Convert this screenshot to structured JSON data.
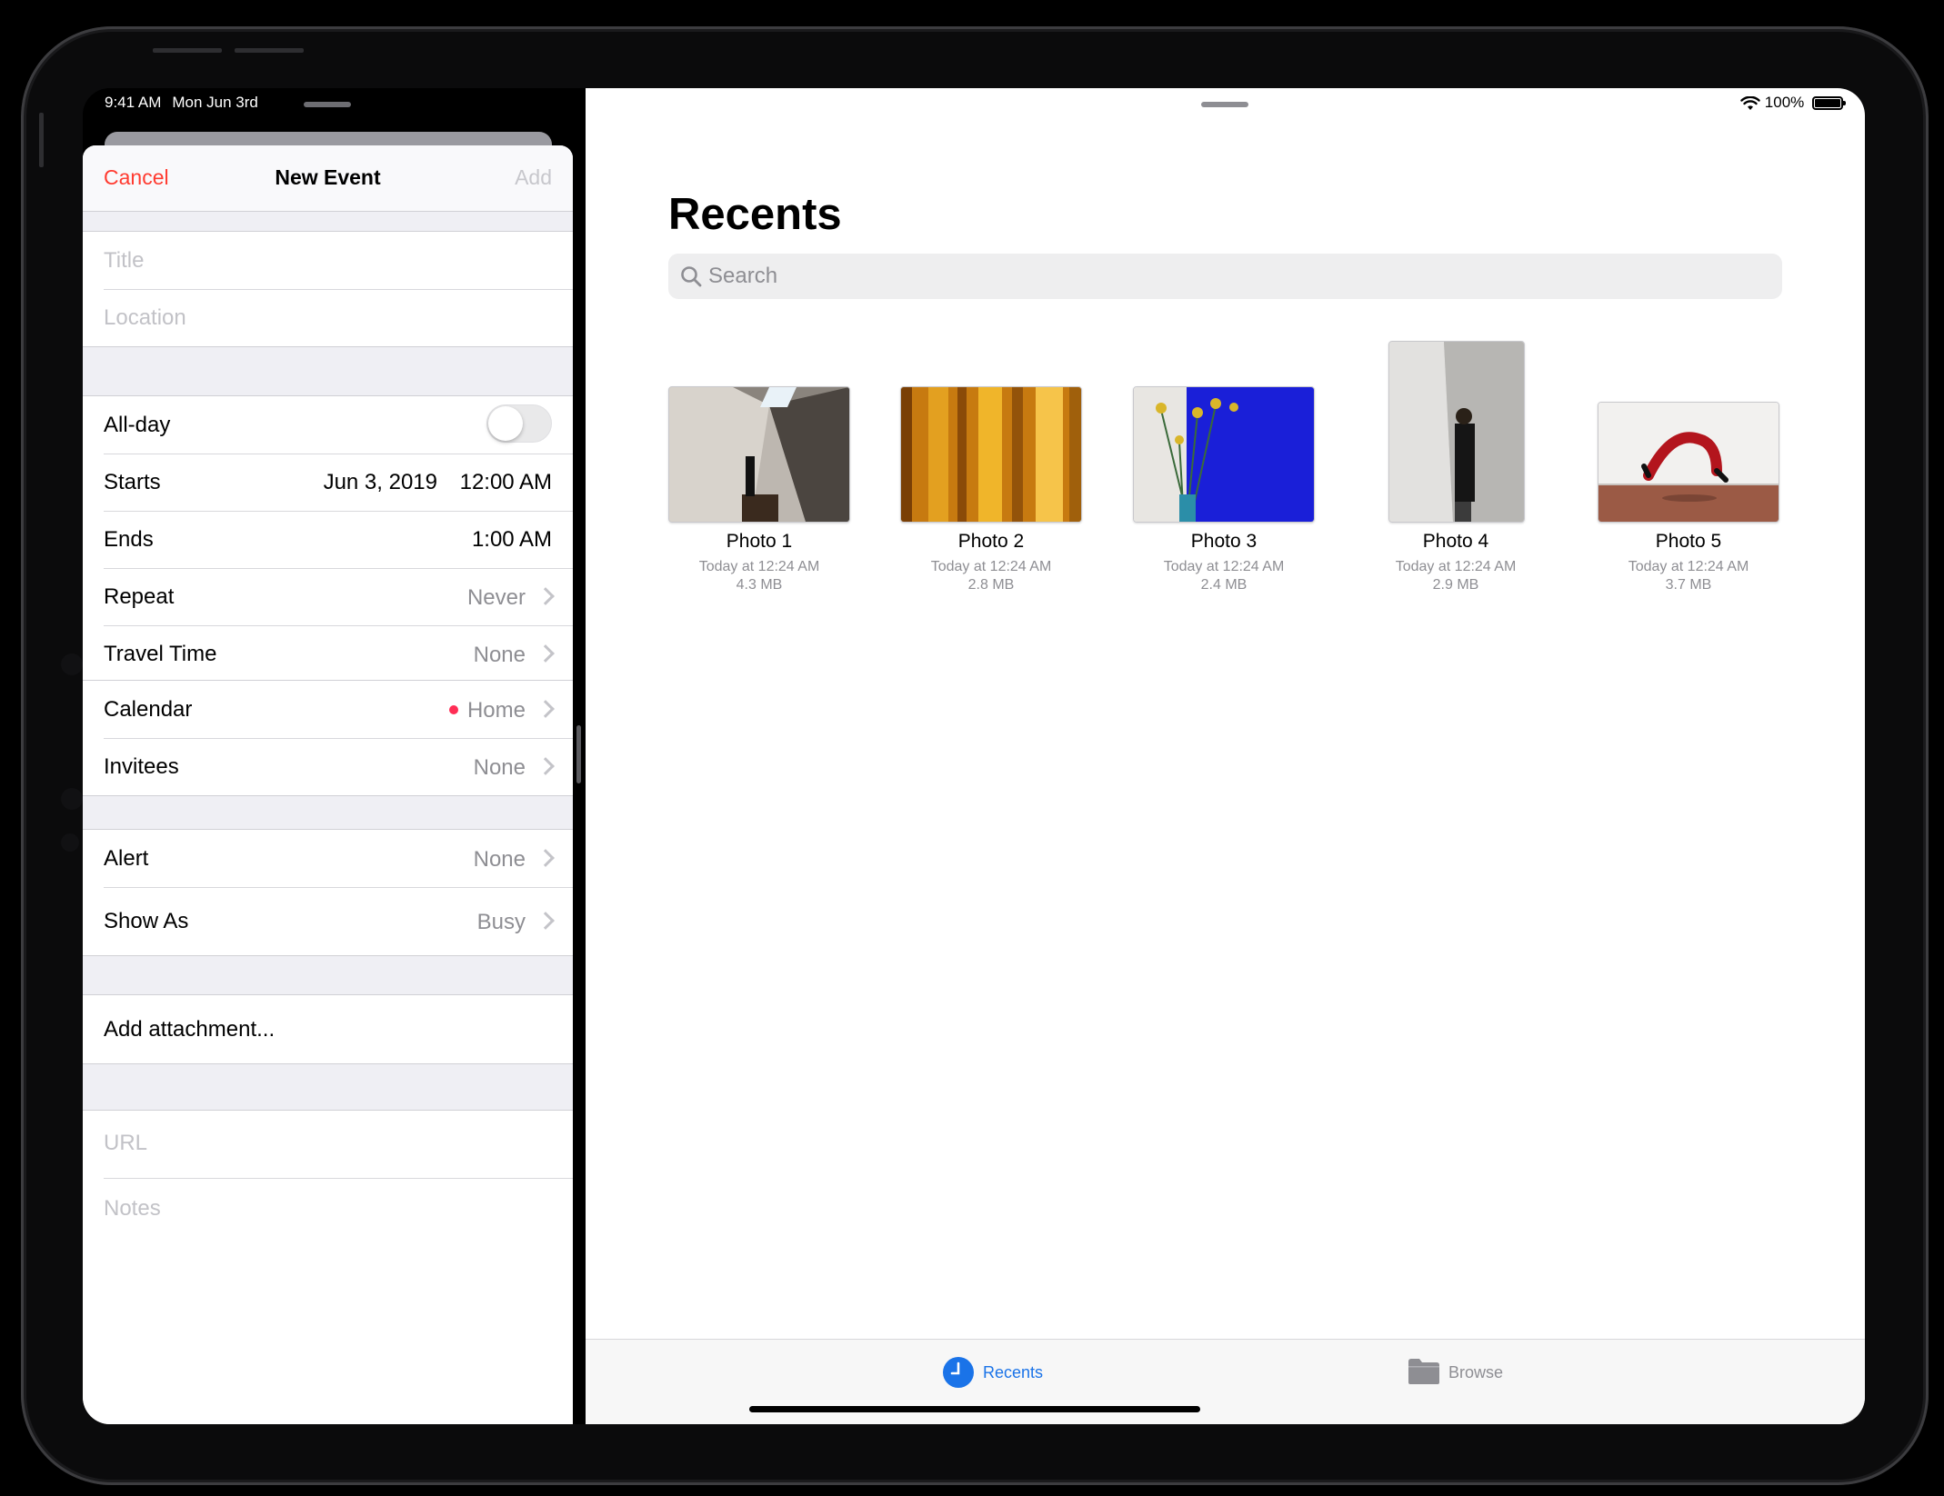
{
  "status_bar": {
    "time": "9:41 AM",
    "date": "Mon Jun 3rd",
    "battery": "100%"
  },
  "calendar": {
    "nav": {
      "cancel": "Cancel",
      "title": "New Event",
      "add": "Add"
    },
    "fields": {
      "title_placeholder": "Title",
      "location_placeholder": "Location"
    },
    "all_day": {
      "label": "All-day",
      "on": false
    },
    "starts": {
      "label": "Starts",
      "date": "Jun 3, 2019",
      "time": "12:00 AM"
    },
    "ends": {
      "label": "Ends",
      "time": "1:00 AM"
    },
    "repeat": {
      "label": "Repeat",
      "value": "Never"
    },
    "travel_time": {
      "label": "Travel Time",
      "value": "None"
    },
    "calendar_row": {
      "label": "Calendar",
      "value": "Home",
      "color": "#ff2d55"
    },
    "invitees": {
      "label": "Invitees",
      "value": "None"
    },
    "alert": {
      "label": "Alert",
      "value": "None"
    },
    "show_as": {
      "label": "Show As",
      "value": "Busy"
    },
    "attachment": {
      "label": "Add attachment..."
    },
    "url_placeholder": "URL",
    "notes_placeholder": "Notes",
    "accent_color": "#ff3b30"
  },
  "files": {
    "title": "Recents",
    "search_placeholder": "Search",
    "items": [
      {
        "name": "Photo 1",
        "date": "Today at 12:24 AM",
        "size": "4.3 MB"
      },
      {
        "name": "Photo 2",
        "date": "Today at 12:24 AM",
        "size": "2.8 MB"
      },
      {
        "name": "Photo 3",
        "date": "Today at 12:24 AM",
        "size": "2.4 MB"
      },
      {
        "name": "Photo 4",
        "date": "Today at 12:24 AM",
        "size": "2.9 MB"
      },
      {
        "name": "Photo 5",
        "date": "Today at 12:24 AM",
        "size": "3.7 MB"
      }
    ],
    "tabs": [
      {
        "label": "Recents",
        "icon": "clock-icon",
        "selected": true
      },
      {
        "label": "Browse",
        "icon": "folder-icon",
        "selected": false
      }
    ],
    "accent_color": "#1a73e8"
  }
}
